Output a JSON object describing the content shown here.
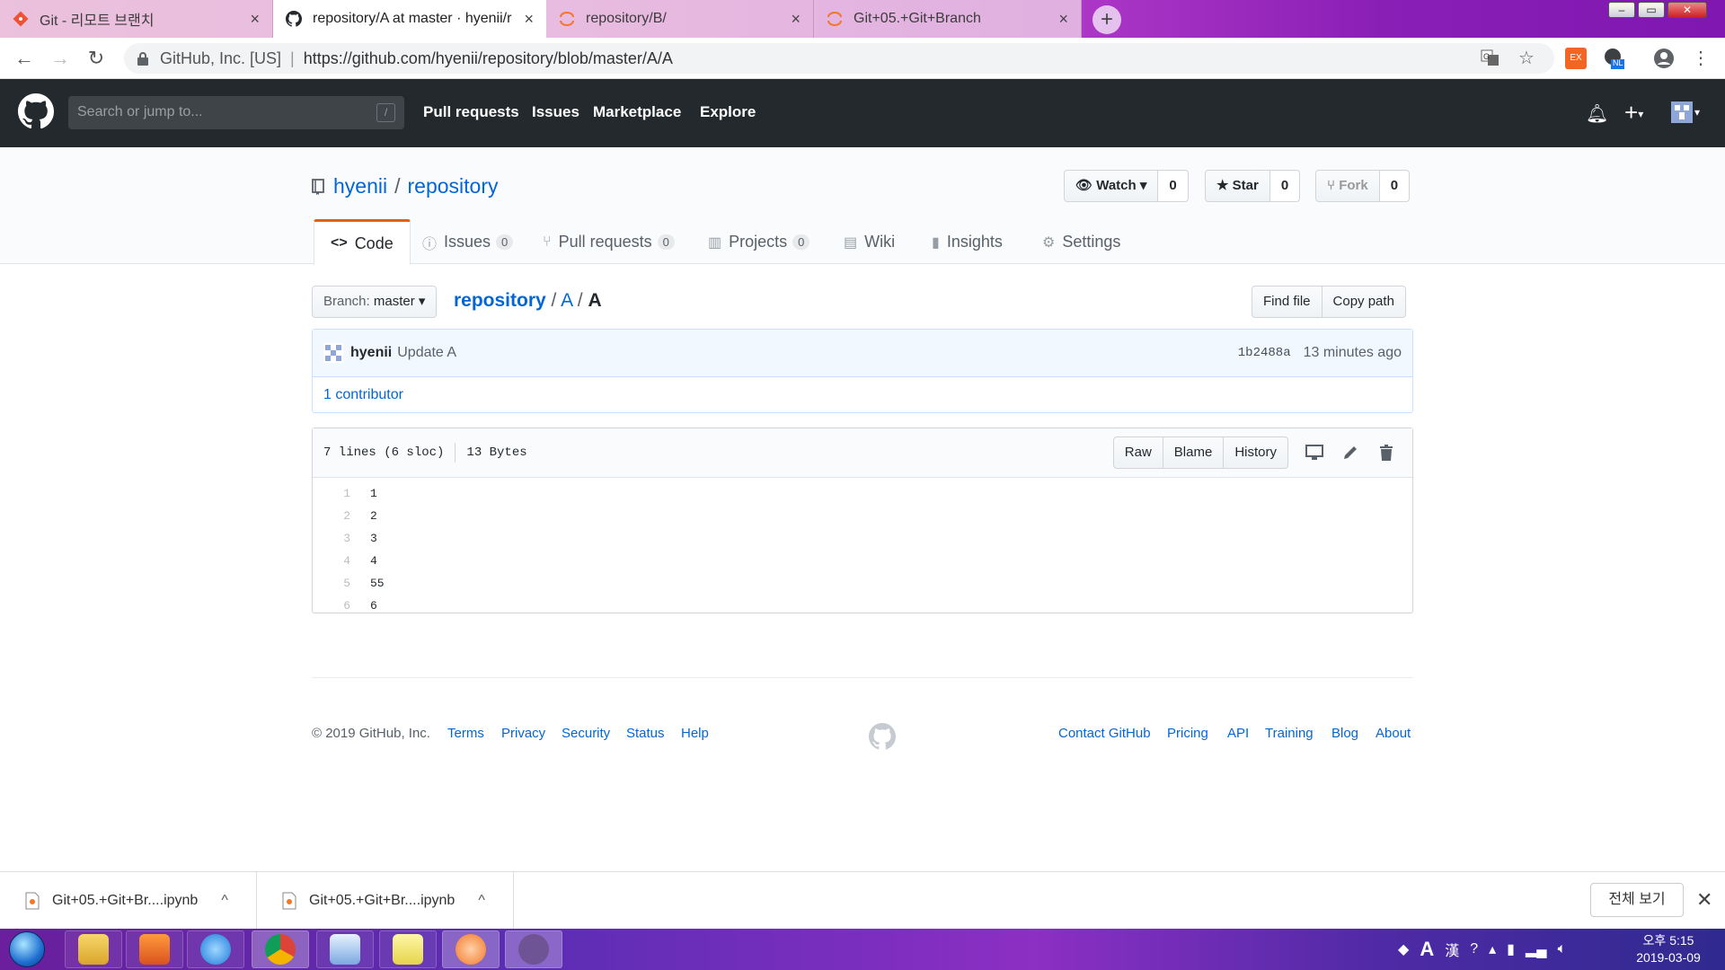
{
  "browser": {
    "tabs": [
      {
        "title": "Git - 리모트 브랜치",
        "icon": "git-icon"
      },
      {
        "title": "repository/A at master · hyenii/r",
        "icon": "github-icon"
      },
      {
        "title": "repository/B/",
        "icon": "jupyter-icon"
      },
      {
        "title": "Git+05.+Git+Branch",
        "icon": "jupyter-icon"
      }
    ],
    "new_tab": "+",
    "close_glyph": "×",
    "address": {
      "org": "GitHub, Inc. [US]",
      "separator": "|",
      "url": "https://github.com/hyenii/repository/blob/master/A/A"
    },
    "ext_badge": "NL",
    "ext_ex": "EX"
  },
  "github": {
    "search_placeholder": "Search or jump to...",
    "search_key": "/",
    "nav": [
      "Pull requests",
      "Issues",
      "Marketplace",
      "Explore"
    ]
  },
  "repo": {
    "owner": "hyenii",
    "separator": "/",
    "name": "repository",
    "watch": {
      "label": "Watch",
      "count": "0"
    },
    "star": {
      "label": "Star",
      "count": "0"
    },
    "fork": {
      "label": "Fork",
      "count": "0"
    },
    "tabs": [
      {
        "label": "Code",
        "icon": "code-icon",
        "glyph": "<>"
      },
      {
        "label": "Issues",
        "icon": "issue-icon",
        "glyph": "ⓘ",
        "count": "0"
      },
      {
        "label": "Pull requests",
        "icon": "pull-request-icon",
        "glyph": "⑂",
        "count": "0"
      },
      {
        "label": "Projects",
        "icon": "project-icon",
        "glyph": "▥",
        "count": "0"
      },
      {
        "label": "Wiki",
        "icon": "book-icon",
        "glyph": "▤"
      },
      {
        "label": "Insights",
        "icon": "graph-icon",
        "glyph": "▮"
      },
      {
        "label": "Settings",
        "icon": "gear-icon",
        "glyph": "⚙"
      }
    ]
  },
  "file_nav": {
    "branch_label": "Branch:",
    "branch": "master",
    "breadcrumb": {
      "root": "repository",
      "sep": "/",
      "dir": "A",
      "file": "A"
    },
    "find_file": "Find file",
    "copy_path": "Copy path"
  },
  "commit": {
    "author": "hyenii",
    "message": "Update A",
    "sha": "1b2488a",
    "time": "13 minutes ago",
    "contributors": "1 contributor"
  },
  "file": {
    "lines_info": "7 lines (6 sloc)",
    "size": "13 Bytes",
    "actions": [
      "Raw",
      "Blame",
      "History"
    ],
    "code": [
      {
        "n": "1",
        "t": "1"
      },
      {
        "n": "2",
        "t": "2"
      },
      {
        "n": "3",
        "t": "3"
      },
      {
        "n": "4",
        "t": "4"
      },
      {
        "n": "5",
        "t": "55"
      },
      {
        "n": "6",
        "t": "6"
      }
    ]
  },
  "footer": {
    "copyright": "© 2019 GitHub, Inc.",
    "left_links": [
      "Terms",
      "Privacy",
      "Security",
      "Status",
      "Help"
    ],
    "right_links": [
      "Contact GitHub",
      "Pricing",
      "API",
      "Training",
      "Blog",
      "About"
    ]
  },
  "downloads": {
    "items": [
      "Git+05.+Git+Br....ipynb",
      "Git+05.+Git+Br....ipynb"
    ],
    "show_all": "전체 보기",
    "chevron": "^"
  },
  "taskbar": {
    "apps": [
      "explorer",
      "media-player",
      "internet-explorer",
      "chrome",
      "app-blue",
      "sticky-notes",
      "jupyter",
      "github-desktop"
    ],
    "tray_ime": "A",
    "tray_hanja": "漢",
    "time": "오후 5:15",
    "date": "2019-03-09"
  },
  "colors": {
    "github_header": "#24292e",
    "link": "#0366d6",
    "selected_tab_accent": "#e36209",
    "commit_bg": "#f1f8ff"
  }
}
